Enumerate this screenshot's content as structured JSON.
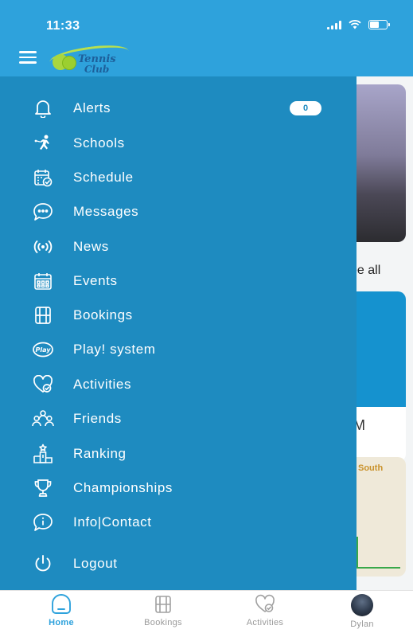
{
  "status_bar": {
    "time": "11:33"
  },
  "header": {
    "logo_line1": "Tennis",
    "logo_line2": "Club"
  },
  "background": {
    "see_all": "ee all",
    "card_text": "M",
    "map_label": "South"
  },
  "menu": {
    "items": [
      {
        "label": "Alerts",
        "icon": "bell-icon",
        "badge": "0"
      },
      {
        "label": "Schools",
        "icon": "tennis-player-icon"
      },
      {
        "label": "Schedule",
        "icon": "calendar-check-icon"
      },
      {
        "label": "Messages",
        "icon": "chat-bubble-icon"
      },
      {
        "label": "News",
        "icon": "broadcast-icon"
      },
      {
        "label": "Events",
        "icon": "calendar-grid-icon"
      },
      {
        "label": "Bookings",
        "icon": "booking-grid-icon"
      },
      {
        "label": "Play! system",
        "icon": "play-logo-icon"
      },
      {
        "label": "Activities",
        "icon": "heart-check-icon"
      },
      {
        "label": "Friends",
        "icon": "people-icon"
      },
      {
        "label": "Ranking",
        "icon": "podium-icon"
      },
      {
        "label": "Championships",
        "icon": "trophy-icon"
      },
      {
        "label": "Info|Contact",
        "icon": "info-chat-icon"
      },
      {
        "label": "Logout",
        "icon": "power-icon"
      }
    ]
  },
  "tabbar": {
    "tabs": [
      {
        "label": "Home",
        "icon": "home-icon",
        "active": true
      },
      {
        "label": "Bookings",
        "icon": "booking-grid-icon"
      },
      {
        "label": "Activities",
        "icon": "heart-check-icon"
      },
      {
        "label": "Dylan",
        "icon": "avatar"
      }
    ]
  },
  "colors": {
    "header": "#2ea2dc",
    "drawer": "#1e8bc0",
    "active_tab": "#2ea2dc"
  }
}
